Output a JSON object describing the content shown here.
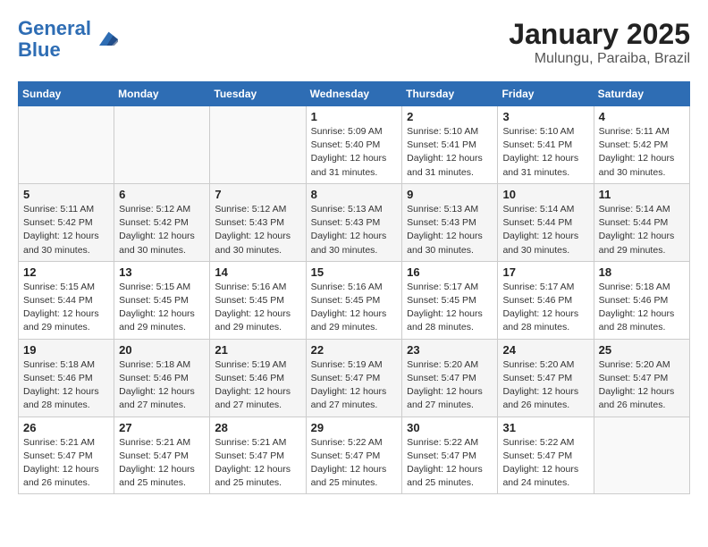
{
  "header": {
    "logo_line1": "General",
    "logo_line2": "Blue",
    "title": "January 2025",
    "subtitle": "Mulungu, Paraiba, Brazil"
  },
  "weekdays": [
    "Sunday",
    "Monday",
    "Tuesday",
    "Wednesday",
    "Thursday",
    "Friday",
    "Saturday"
  ],
  "weeks": [
    [
      {
        "day": "",
        "info": ""
      },
      {
        "day": "",
        "info": ""
      },
      {
        "day": "",
        "info": ""
      },
      {
        "day": "1",
        "info": "Sunrise: 5:09 AM\nSunset: 5:40 PM\nDaylight: 12 hours and 31 minutes."
      },
      {
        "day": "2",
        "info": "Sunrise: 5:10 AM\nSunset: 5:41 PM\nDaylight: 12 hours and 31 minutes."
      },
      {
        "day": "3",
        "info": "Sunrise: 5:10 AM\nSunset: 5:41 PM\nDaylight: 12 hours and 31 minutes."
      },
      {
        "day": "4",
        "info": "Sunrise: 5:11 AM\nSunset: 5:42 PM\nDaylight: 12 hours and 30 minutes."
      }
    ],
    [
      {
        "day": "5",
        "info": "Sunrise: 5:11 AM\nSunset: 5:42 PM\nDaylight: 12 hours and 30 minutes."
      },
      {
        "day": "6",
        "info": "Sunrise: 5:12 AM\nSunset: 5:42 PM\nDaylight: 12 hours and 30 minutes."
      },
      {
        "day": "7",
        "info": "Sunrise: 5:12 AM\nSunset: 5:43 PM\nDaylight: 12 hours and 30 minutes."
      },
      {
        "day": "8",
        "info": "Sunrise: 5:13 AM\nSunset: 5:43 PM\nDaylight: 12 hours and 30 minutes."
      },
      {
        "day": "9",
        "info": "Sunrise: 5:13 AM\nSunset: 5:43 PM\nDaylight: 12 hours and 30 minutes."
      },
      {
        "day": "10",
        "info": "Sunrise: 5:14 AM\nSunset: 5:44 PM\nDaylight: 12 hours and 30 minutes."
      },
      {
        "day": "11",
        "info": "Sunrise: 5:14 AM\nSunset: 5:44 PM\nDaylight: 12 hours and 29 minutes."
      }
    ],
    [
      {
        "day": "12",
        "info": "Sunrise: 5:15 AM\nSunset: 5:44 PM\nDaylight: 12 hours and 29 minutes."
      },
      {
        "day": "13",
        "info": "Sunrise: 5:15 AM\nSunset: 5:45 PM\nDaylight: 12 hours and 29 minutes."
      },
      {
        "day": "14",
        "info": "Sunrise: 5:16 AM\nSunset: 5:45 PM\nDaylight: 12 hours and 29 minutes."
      },
      {
        "day": "15",
        "info": "Sunrise: 5:16 AM\nSunset: 5:45 PM\nDaylight: 12 hours and 29 minutes."
      },
      {
        "day": "16",
        "info": "Sunrise: 5:17 AM\nSunset: 5:45 PM\nDaylight: 12 hours and 28 minutes."
      },
      {
        "day": "17",
        "info": "Sunrise: 5:17 AM\nSunset: 5:46 PM\nDaylight: 12 hours and 28 minutes."
      },
      {
        "day": "18",
        "info": "Sunrise: 5:18 AM\nSunset: 5:46 PM\nDaylight: 12 hours and 28 minutes."
      }
    ],
    [
      {
        "day": "19",
        "info": "Sunrise: 5:18 AM\nSunset: 5:46 PM\nDaylight: 12 hours and 28 minutes."
      },
      {
        "day": "20",
        "info": "Sunrise: 5:18 AM\nSunset: 5:46 PM\nDaylight: 12 hours and 27 minutes."
      },
      {
        "day": "21",
        "info": "Sunrise: 5:19 AM\nSunset: 5:46 PM\nDaylight: 12 hours and 27 minutes."
      },
      {
        "day": "22",
        "info": "Sunrise: 5:19 AM\nSunset: 5:47 PM\nDaylight: 12 hours and 27 minutes."
      },
      {
        "day": "23",
        "info": "Sunrise: 5:20 AM\nSunset: 5:47 PM\nDaylight: 12 hours and 27 minutes."
      },
      {
        "day": "24",
        "info": "Sunrise: 5:20 AM\nSunset: 5:47 PM\nDaylight: 12 hours and 26 minutes."
      },
      {
        "day": "25",
        "info": "Sunrise: 5:20 AM\nSunset: 5:47 PM\nDaylight: 12 hours and 26 minutes."
      }
    ],
    [
      {
        "day": "26",
        "info": "Sunrise: 5:21 AM\nSunset: 5:47 PM\nDaylight: 12 hours and 26 minutes."
      },
      {
        "day": "27",
        "info": "Sunrise: 5:21 AM\nSunset: 5:47 PM\nDaylight: 12 hours and 25 minutes."
      },
      {
        "day": "28",
        "info": "Sunrise: 5:21 AM\nSunset: 5:47 PM\nDaylight: 12 hours and 25 minutes."
      },
      {
        "day": "29",
        "info": "Sunrise: 5:22 AM\nSunset: 5:47 PM\nDaylight: 12 hours and 25 minutes."
      },
      {
        "day": "30",
        "info": "Sunrise: 5:22 AM\nSunset: 5:47 PM\nDaylight: 12 hours and 25 minutes."
      },
      {
        "day": "31",
        "info": "Sunrise: 5:22 AM\nSunset: 5:47 PM\nDaylight: 12 hours and 24 minutes."
      },
      {
        "day": "",
        "info": ""
      }
    ]
  ]
}
